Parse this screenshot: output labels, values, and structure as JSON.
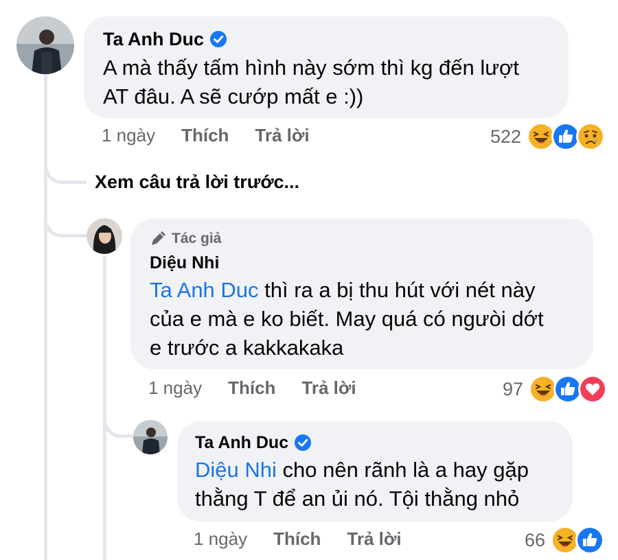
{
  "comment1": {
    "author": "Ta Anh Duc",
    "text_line1": "A mà thấy tấm hình này sớm thì kg đến lượt",
    "text_line2": "AT đâu. A sẽ cướp mất e :))",
    "time": "1 ngày",
    "like_label": "Thích",
    "reply_label": "Trả lời",
    "reaction_count": "522",
    "reactions": [
      "haha-icon",
      "like-icon",
      "sad-icon"
    ]
  },
  "see_previous": "Xem câu trả lời trước...",
  "comment2": {
    "badge": "Tác giả",
    "author": "Diệu Nhi",
    "mention": "Ta Anh Duc",
    "text_line1_rest": " thì ra a bị thu hút với nét này",
    "text_line2": "của e mà e ko biết. May quá có ngưòi dớt",
    "text_line3": "e trước a kakkakaka",
    "time": "1 ngày",
    "like_label": "Thích",
    "reply_label": "Trả lời",
    "reaction_count": "97",
    "reactions": [
      "haha-icon",
      "like-icon",
      "love-icon"
    ]
  },
  "comment3": {
    "author": "Ta Anh Duc",
    "mention": "Diệu Nhi",
    "text_line1_rest": " cho nên rãnh là a hay gặp",
    "text_line2": "thằng T để an ủi nó. Tội thằng nhỏ",
    "time": "1 ngày",
    "like_label": "Thích",
    "reply_label": "Trả lời",
    "reaction_count": "66",
    "reactions": [
      "haha-icon",
      "like-icon"
    ]
  },
  "colors": {
    "mention": "#1b74e4",
    "bubble": "#f0f2f5",
    "meta": "#65676b",
    "verified": "#1877f2"
  }
}
